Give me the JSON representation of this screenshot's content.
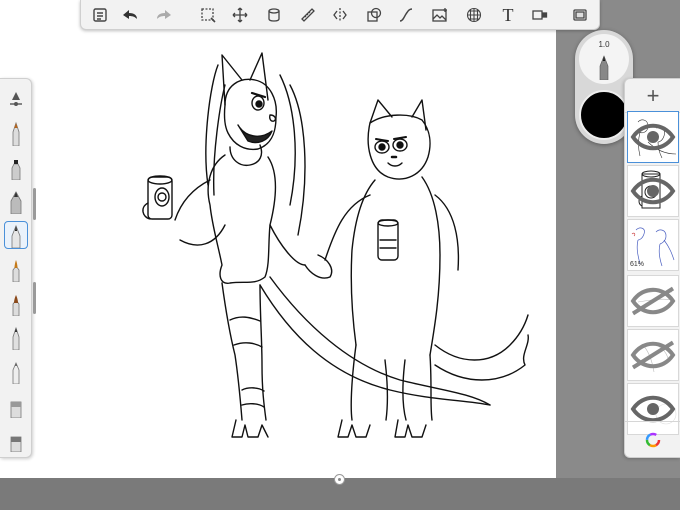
{
  "toolbar": {
    "items": [
      {
        "name": "lists-icon"
      },
      {
        "name": "undo-icon"
      },
      {
        "name": "redo-icon"
      },
      {
        "name": "selection-icon"
      },
      {
        "name": "transform-icon"
      },
      {
        "name": "layer-stack-icon"
      },
      {
        "name": "ruler-icon"
      },
      {
        "name": "symmetry-icon"
      },
      {
        "name": "shapes-icon"
      },
      {
        "name": "curve-icon"
      },
      {
        "name": "image-icon"
      },
      {
        "name": "perspective-grid-icon"
      },
      {
        "name": "text-icon",
        "label": "T"
      },
      {
        "name": "video-icon"
      },
      {
        "name": "fullscreen-icon"
      }
    ]
  },
  "brushes": [
    {
      "name": "brush-library-icon"
    },
    {
      "name": "pencil-brush",
      "tip": "#b5651d"
    },
    {
      "name": "marker-brush",
      "tip": "#222"
    },
    {
      "name": "airbrush-brush",
      "tip": "#333"
    },
    {
      "name": "inking-pen-brush",
      "tip": "#111",
      "selected": true
    },
    {
      "name": "paintbrush-brush",
      "tip": "#c47a1a"
    },
    {
      "name": "hard-brush",
      "tip": "#8b4a1b"
    },
    {
      "name": "fineliner-brush",
      "tip": "#222"
    },
    {
      "name": "ballpoint-brush",
      "tip": "#555"
    },
    {
      "name": "eraser-brush",
      "tip": "#999"
    },
    {
      "name": "smudge-brush",
      "tip": "#777"
    }
  ],
  "puck": {
    "size_value": "1.0",
    "color": "#000000"
  },
  "layers": {
    "add_label": "+",
    "items": [
      {
        "name": "layer-lineart",
        "active": true
      },
      {
        "name": "layer-cup-sketch"
      },
      {
        "name": "layer-reference",
        "opacity_label": "61%"
      },
      {
        "name": "layer-sketch-lines"
      },
      {
        "name": "layer-sketch-curve"
      },
      {
        "name": "layer-blank"
      }
    ]
  }
}
